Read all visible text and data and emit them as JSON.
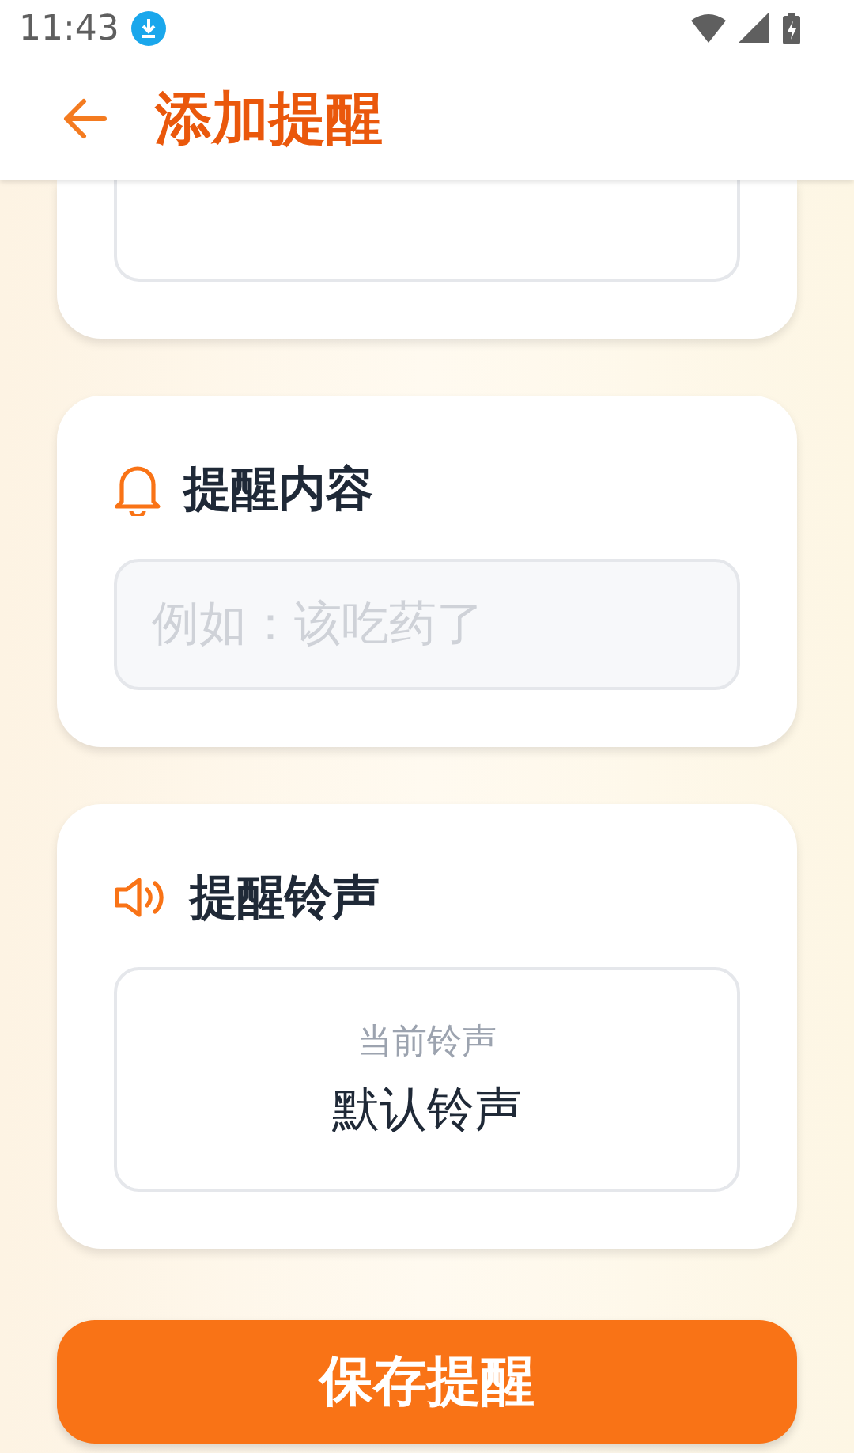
{
  "status_bar": {
    "time": "11:43"
  },
  "app_bar": {
    "title": "添加提醒"
  },
  "content_card": {
    "title": "提醒内容",
    "input": {
      "placeholder": "例如：该吃药了"
    }
  },
  "ringtone_card": {
    "title": "提醒铃声",
    "caption": "当前铃声",
    "value": "默认铃声"
  },
  "save_button": {
    "label": "保存提醒"
  }
}
